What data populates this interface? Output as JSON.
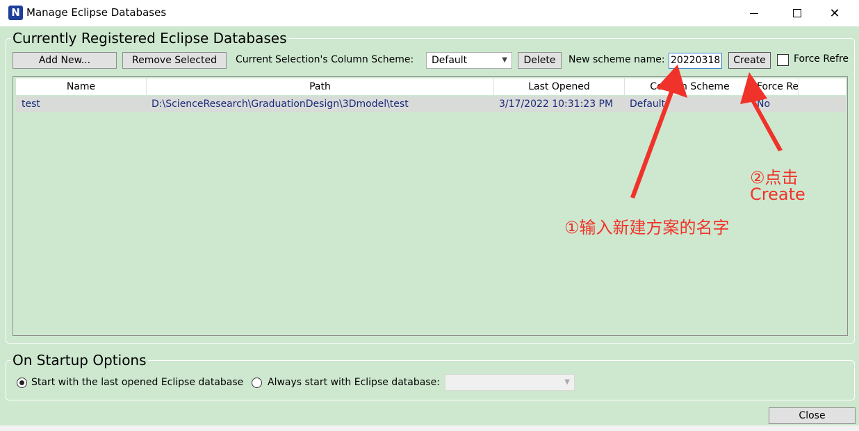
{
  "window": {
    "title": "Manage Eclipse Databases",
    "app_icon_letter": "N",
    "controls": {
      "minimize": "—",
      "maximize": "☐",
      "close": "✕"
    }
  },
  "databases_group": {
    "title": "Currently Registered Eclipse Databases",
    "add_new_label": "Add New...",
    "remove_selected_label": "Remove Selected",
    "column_scheme_label": "Current Selection's Column Scheme:",
    "column_scheme_value": "Default",
    "delete_label": "Delete",
    "new_scheme_label": "New scheme name:",
    "new_scheme_value": "20220318",
    "create_label": "Create",
    "force_refresh_label": "Force Refre",
    "force_refresh_checked": false
  },
  "table": {
    "columns": [
      "Name",
      "Path",
      "Last Opened",
      "Column Scheme",
      "Force Re"
    ],
    "rows": [
      {
        "name": "test",
        "path": "D:\\ScienceResearch\\GraduationDesign\\3Dmodel\\test",
        "last_opened": "3/17/2022 10:31:23 PM",
        "column_scheme": "Default",
        "force_refresh": "No"
      }
    ]
  },
  "startup_group": {
    "title": "On Startup Options",
    "option_last_label": "Start with the last opened Eclipse database",
    "option_last_selected": true,
    "option_always_label": "Always start with Eclipse database:",
    "option_always_selected": false,
    "database_select_value": ""
  },
  "footer": {
    "close_label": "Close"
  },
  "annotations": {
    "step2_line1": "②点击",
    "step2_line2": "Create",
    "step1": "①输入新建方案的名字",
    "color": "#f0332a"
  }
}
